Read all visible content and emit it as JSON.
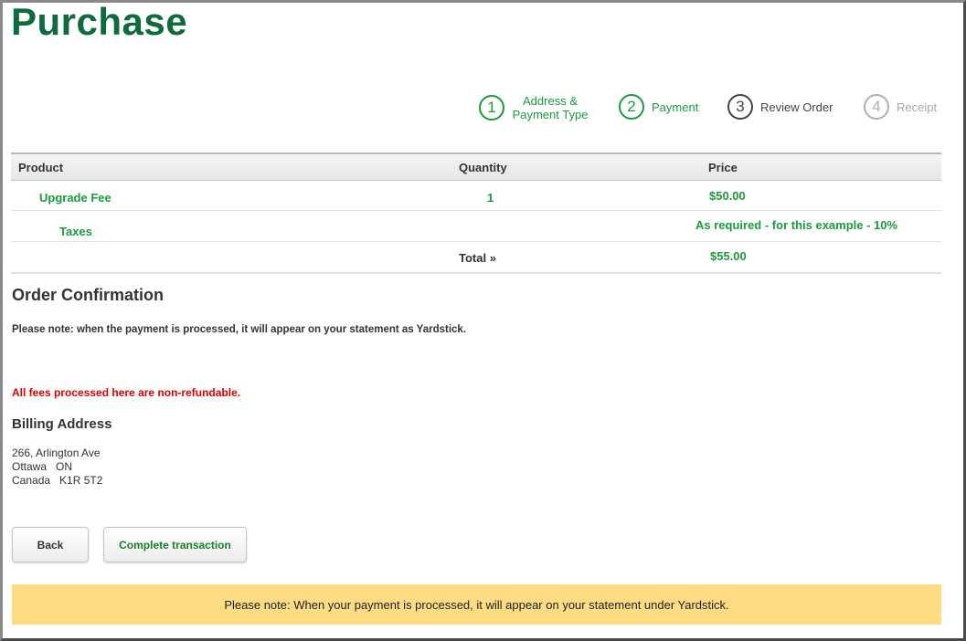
{
  "page": {
    "title": "Purchase"
  },
  "steps": [
    {
      "number": "1",
      "label": "Address &\nPayment Type"
    },
    {
      "number": "2",
      "label": "Payment"
    },
    {
      "number": "3",
      "label": "Review Order"
    },
    {
      "number": "4",
      "label": "Receipt"
    }
  ],
  "table": {
    "headers": {
      "product": "Product",
      "quantity": "Quantity",
      "price": "Price"
    },
    "rows": [
      {
        "product": "Upgrade Fee",
        "quantity": "1",
        "price": "$50.00"
      },
      {
        "product": "Taxes",
        "quantity": "",
        "price": "As required - for this example - 10%"
      }
    ],
    "total_label": "Total »",
    "total_value": "$55.00"
  },
  "confirmation": {
    "title": "Order Confirmation",
    "note": "Please note: when the payment is processed, it will appear on your statement as Yardstick.",
    "warning": "All fees processed here are non-refundable."
  },
  "billing": {
    "title": "Billing Address",
    "lines": [
      "266, Arlington Ave",
      "Ottawa   ON",
      "Canada   K1R 5T2"
    ]
  },
  "buttons": {
    "back": "Back",
    "complete": "Complete transaction"
  },
  "banner": {
    "text": "Please note: When your payment is processed, it will appear on your statement under Yardstick."
  },
  "colors": {
    "brand_green": "#0d6b3e",
    "accent_green": "#1a9b3c",
    "warning_red": "#e00000",
    "banner_yellow": "#fddc84"
  }
}
